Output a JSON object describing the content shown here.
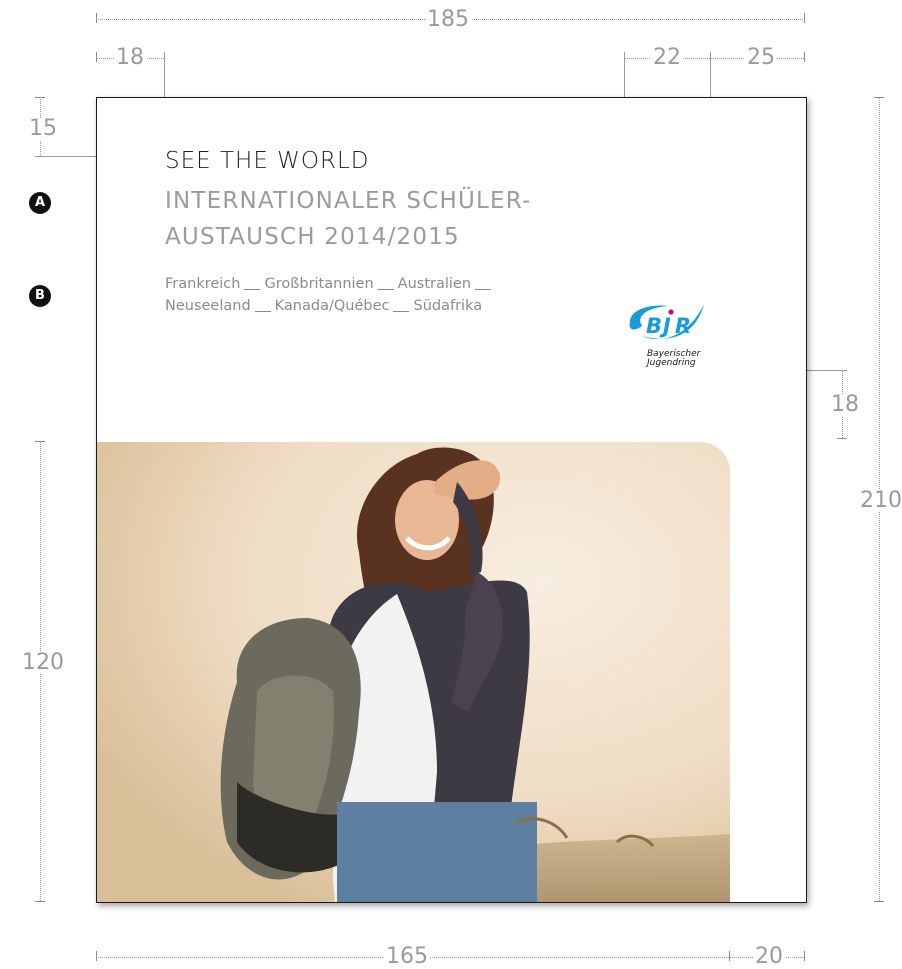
{
  "cover": {
    "title": "SEE THE WORLD",
    "subtitle_line1": "INTERNATIONALER SCHÜLER-",
    "subtitle_line2": "AUSTAUSCH 2014/2015",
    "countries_line1": [
      "Frankreich",
      "Großbritannien",
      "Australien",
      ""
    ],
    "countries_line2": [
      "Neuseeland",
      "Kanada/Québec",
      "Südafrika"
    ]
  },
  "logo": {
    "letters": "BJR",
    "tagline_line1": "Bayerischer",
    "tagline_line2": "Jugendring",
    "color": "#1a9ad6",
    "dot_color": "#d6006f"
  },
  "markers": {
    "a": "A",
    "b": "B"
  },
  "dimensions": {
    "total_width": "185",
    "left_margin": "18",
    "logo_offset": "22",
    "right_margin": "25",
    "top_margin": "15",
    "total_height": "210",
    "logo_bottom": "18",
    "corner_radius_x": "10",
    "corner_radius_y": "10",
    "photo_height": "120",
    "photo_width": "165",
    "photo_right": "20"
  },
  "photo": {
    "subject": "smiling-woman-with-backpack"
  }
}
